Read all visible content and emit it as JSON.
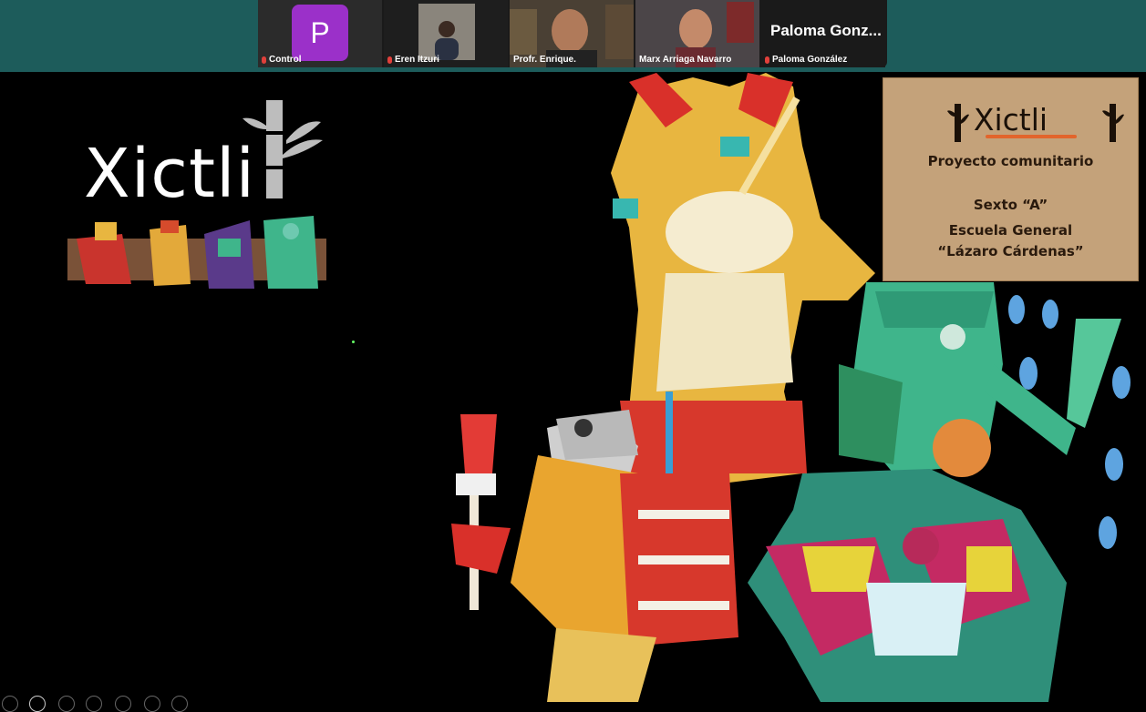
{
  "participants": [
    {
      "name": "Control",
      "type": "avatar",
      "initial": "P",
      "muted": true
    },
    {
      "name": "Eren Itzuri",
      "type": "video",
      "muted": true
    },
    {
      "name": "Profr. Enrique.",
      "type": "video",
      "muted": false
    },
    {
      "name": "Marx Arriaga Navarro",
      "type": "video",
      "muted": false,
      "active_speaker": true
    },
    {
      "name": "Paloma González",
      "type": "name-only",
      "display": "Paloma Gonz...",
      "muted": true
    }
  ],
  "slide": {
    "logo": "Xictli",
    "card": {
      "brand": "Xictli",
      "line1": "Proyecto comunitario",
      "line2": "Sexto “A”",
      "line3": "Escuela General",
      "line4": "“Lázaro Cárdenas”"
    }
  },
  "colors": {
    "topbar": "#1d5c5b",
    "avatar": "#9b30c9",
    "active_border": "#3cc95b",
    "accent_underline": "#e2652c"
  }
}
